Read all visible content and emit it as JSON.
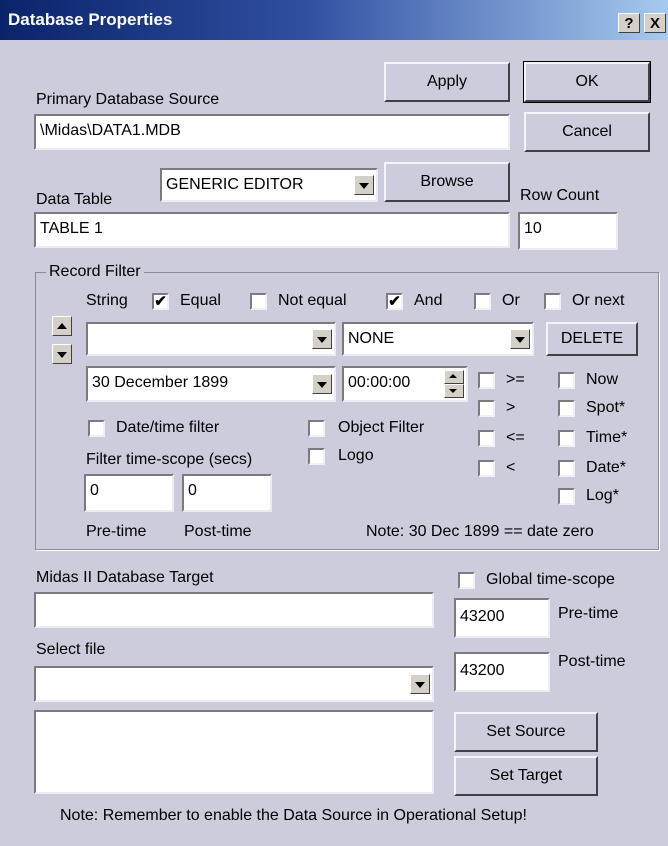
{
  "dialog": {
    "title": "Database Properties",
    "help_button": "?",
    "close_button": "X",
    "colors": {
      "titlebar_start": "#0a246a",
      "titlebar_end": "#a6caf0",
      "face": "#ccccdd"
    }
  },
  "top_buttons": {
    "apply": "Apply",
    "ok": "OK",
    "cancel": "Cancel",
    "browse": "Browse"
  },
  "primary_source": {
    "label": "Primary Database Source",
    "value": "\\Midas\\DATA1.MDB"
  },
  "editor_select": {
    "value": "GENERIC EDITOR"
  },
  "data_table": {
    "label": "Data Table",
    "value": "TABLE 1"
  },
  "row_count": {
    "label": "Row Count",
    "value": "10"
  },
  "record_filter": {
    "title": "Record Filter",
    "string_label": "String",
    "equal": {
      "label": "Equal",
      "checked": true,
      "mark": "✔"
    },
    "not_equal": {
      "label": "Not equal",
      "checked": false,
      "mark": ""
    },
    "and": {
      "label": "And",
      "checked": true,
      "mark": "✔"
    },
    "or": {
      "label": "Or",
      "checked": false,
      "mark": ""
    },
    "or_next": {
      "label": "Or next",
      "checked": false,
      "mark": ""
    },
    "field_select": {
      "value": ""
    },
    "value_select": {
      "value": "NONE"
    },
    "delete_button": "DELETE",
    "date_select": {
      "value": "30 December 1899"
    },
    "time_input": {
      "value": "00:00:00"
    },
    "operators": [
      ">=",
      ">",
      "<=",
      "<"
    ],
    "right_checks": [
      "Now",
      "Spot*",
      "Time*",
      "Date*",
      "Log*"
    ],
    "date_time_filter": "Date/time filter",
    "object_filter": "Object Filter",
    "logo": "Logo",
    "scope_label": "Filter time-scope (secs)",
    "pre_time_value": "0",
    "post_time_value": "0",
    "pre_time_label": "Pre-time",
    "post_time_label": "Post-time",
    "note": "Note: 30 Dec 1899 == date zero"
  },
  "target": {
    "label": "Midas II Database Target",
    "value": "",
    "global_scope": "Global time-scope",
    "pre_value": "43200",
    "pre_label": "Pre-time",
    "post_value": "43200",
    "post_label": "Post-time",
    "select_file_label": "Select file",
    "select_file_value": "",
    "list_value": "",
    "set_source": "Set Source",
    "set_target": "Set Target"
  },
  "footer_note": "Note:  Remember to enable the Data Source in Operational Setup!"
}
